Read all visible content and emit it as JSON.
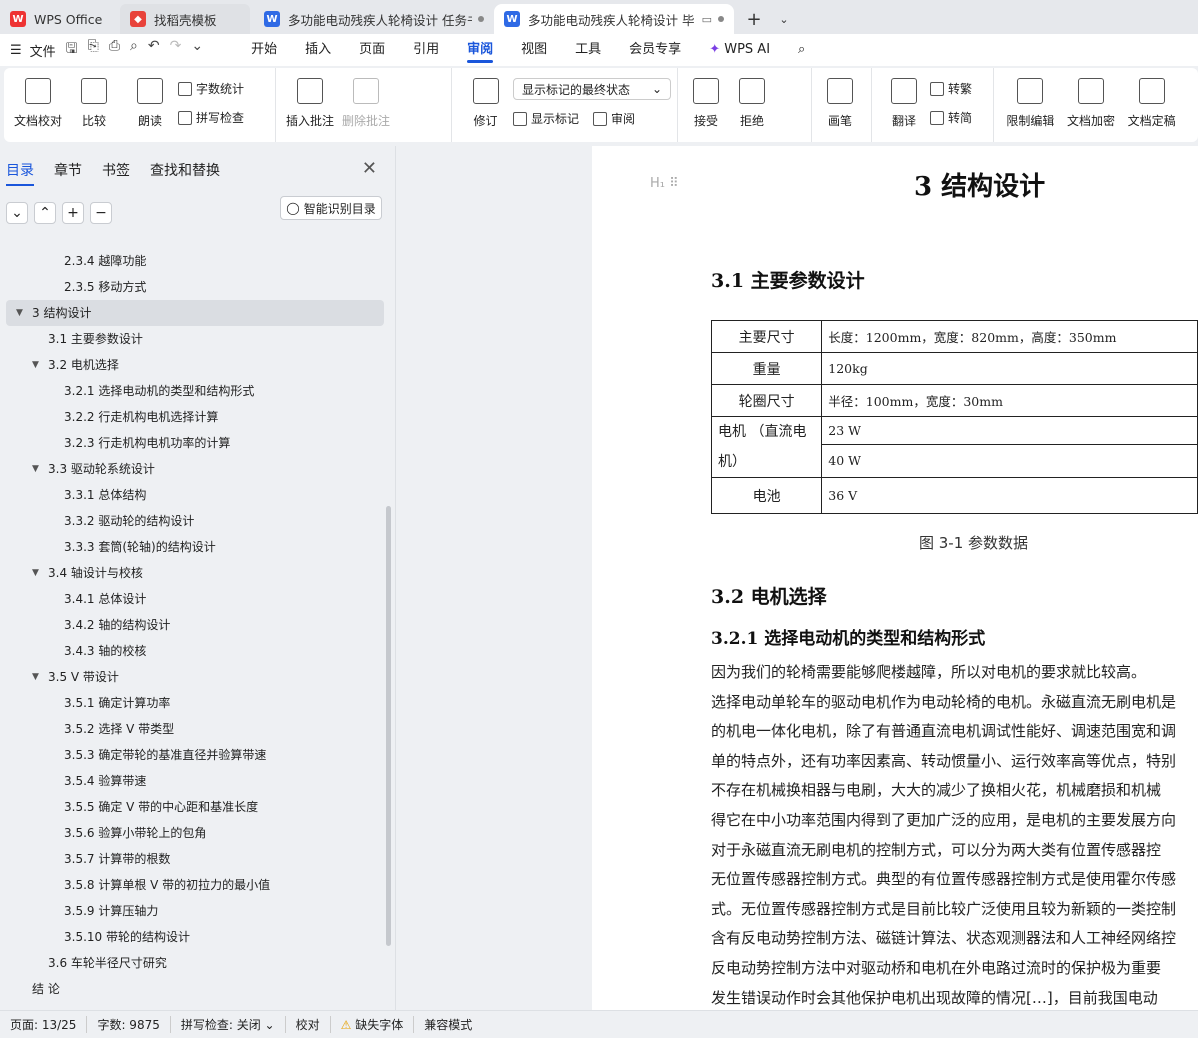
{
  "tabs": [
    {
      "label": "WPS Office",
      "icon": "wps-logo-icon"
    },
    {
      "label": "找稻壳模板",
      "icon": "docer-icon"
    },
    {
      "label": "多功能电动残疾人轮椅设计 任务书",
      "icon": "writer-doc-icon"
    },
    {
      "label": "多功能电动残疾人轮椅设计 毕",
      "icon": "writer-doc-icon"
    }
  ],
  "menu": {
    "file": "文件",
    "tabs": [
      "开始",
      "插入",
      "页面",
      "引用",
      "审阅",
      "视图",
      "工具",
      "会员专享"
    ],
    "active_tab": "审阅",
    "ai": "WPS AI"
  },
  "ribbon": {
    "doc_proof": "文档校对",
    "compare": "比较",
    "read_aloud": "朗读",
    "word_count": "字数统计",
    "spell_check": "拼写检查",
    "insert_comment": "插入批注",
    "delete_comment": "删除批注",
    "revise": "修订",
    "markup_state": "显示标记的最终状态",
    "show_markup": "显示标记",
    "review": "审阅",
    "accept": "接受",
    "reject": "拒绝",
    "pen": "画笔",
    "translate": "翻译",
    "to_traditional": "转繁",
    "to_simplified": "转简",
    "restrict_edit": "限制编辑",
    "encrypt": "文档加密",
    "finalize": "文档定稿"
  },
  "sidebar": {
    "tabs": [
      "目录",
      "章节",
      "书签",
      "查找和替换"
    ],
    "smart_button": "智能识别目录",
    "toc": [
      {
        "text": "2.3.4  越障功能",
        "level": 3
      },
      {
        "text": "2.3.5  移动方式",
        "level": 3
      },
      {
        "text": "3  结构设计",
        "level": 1,
        "selected": true,
        "expanded": true
      },
      {
        "text": "3.1  主要参数设计",
        "level": 2
      },
      {
        "text": "3.2  电机选择",
        "level": 2,
        "expanded": true
      },
      {
        "text": "3.2.1  选择电动机的类型和结构形式",
        "level": 3
      },
      {
        "text": "3.2.2  行走机构电机选择计算",
        "level": 3
      },
      {
        "text": "3.2.3  行走机构电机功率的计算",
        "level": 3
      },
      {
        "text": "3.3  驱动轮系统设计",
        "level": 2,
        "expanded": true
      },
      {
        "text": "3.3.1  总体结构",
        "level": 3
      },
      {
        "text": "3.3.2  驱动轮的结构设计",
        "level": 3
      },
      {
        "text": "3.3.3 套筒(轮轴)的结构设计",
        "level": 3
      },
      {
        "text": "3.4  轴设计与校核",
        "level": 2,
        "expanded": true
      },
      {
        "text": "3.4.1  总体设计",
        "level": 3
      },
      {
        "text": "3.4.2  轴的结构设计",
        "level": 3
      },
      {
        "text": "3.4.3  轴的校核",
        "level": 3
      },
      {
        "text": "3.5 V 带设计",
        "level": 2,
        "expanded": true
      },
      {
        "text": "3.5.1 确定计算功率",
        "level": 3
      },
      {
        "text": "3.5.2  选择 V 带类型",
        "level": 3
      },
      {
        "text": "3.5.3 确定带轮的基准直径并验算带速",
        "level": 3
      },
      {
        "text": "3.5.4 验算带速",
        "level": 3
      },
      {
        "text": "3.5.5 确定 V 带的中心距和基准长度",
        "level": 3
      },
      {
        "text": "3.5.6 验算小带轮上的包角",
        "level": 3
      },
      {
        "text": "3.5.7  计算带的根数",
        "level": 3
      },
      {
        "text": "3.5.8  计算单根 V 带的初拉力的最小值",
        "level": 3
      },
      {
        "text": "3.5.9  计算压轴力",
        "level": 3
      },
      {
        "text": "3.5.10  带轮的结构设计",
        "level": 3
      },
      {
        "text": "3.6  车轮半径尺寸研究",
        "level": 2
      },
      {
        "text": "结    论",
        "level": 1
      }
    ]
  },
  "document": {
    "heading_marker": "H₁",
    "chapter_title": "3  结构设计",
    "sec_3_1": "3.1  主要参数设计",
    "table": [
      {
        "key": "主要尺寸",
        "value": "长度：1200mm，宽度：820mm，高度：350mm"
      },
      {
        "key": "重量",
        "value": "120kg"
      },
      {
        "key": "轮圈尺寸",
        "value": "半径：100mm，宽度：30mm"
      },
      {
        "key": "电机      （直流电机）",
        "value1": "23 W",
        "value2": "40 W"
      },
      {
        "key": "电池",
        "value": "36 V"
      }
    ],
    "caption": "图 3-1 参数数据",
    "sec_3_2": "3.2  电机选择",
    "sec_3_2_1": "3.2.1  选择电动机的类型和结构形式",
    "paragraph": [
      "    因为我们的轮椅需要能够爬楼越障，所以对电机的要求就比较高。",
      "选择电动单轮车的驱动电机作为电动轮椅的电机。永磁直流无刷电机是",
      "的机电一体化电机，除了有普通直流电机调试性能好、调速范围宽和调",
      "单的特点外，还有功率因素高、转动惯量小、运行效率高等优点，特别",
      "不存在机械换相器与电刷，大大的减少了换相火花，机械磨损和机械",
      "得它在中小功率范围内得到了更加广泛的应用，是电机的主要发展方向",
      "对于永磁直流无刷电机的控制方式，可以分为两大类有位置传感器控",
      "无位置传感器控制方式。典型的有位置传感器控制方式是使用霍尔传感",
      "式。无位置传感器控制方式是目前比较广泛使用且较为新颖的一类控制",
      "含有反电动势控制方法、磁链计算法、状态观测器法和人工神经网络控",
      "反电动势控制方法中对驱动桥和电机在外电路过流时的保护极为重要",
      "发生错误动作时会其他保护电机出现故障的情况[…]，目前我国电动"
    ]
  },
  "status": {
    "page": "页面: 13/25",
    "words": "字数: 9875",
    "spell": "拼写检查: 关闭",
    "proof": "校对",
    "missing_font": "缺失字体",
    "compat": "兼容模式"
  }
}
